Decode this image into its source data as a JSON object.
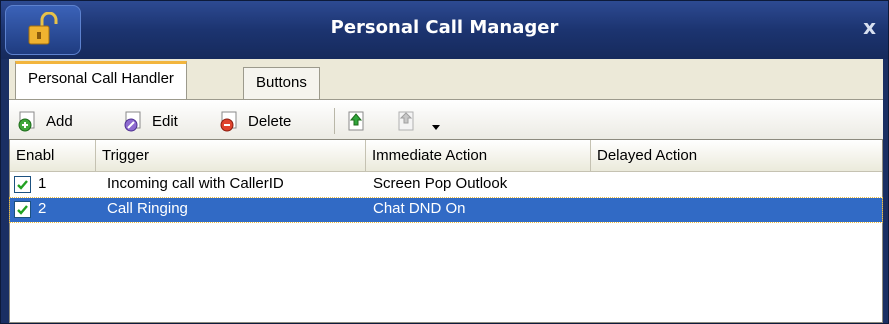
{
  "window": {
    "title": "Personal Call Manager",
    "close_glyph": "x",
    "lock_icon": "unlocked-padlock-icon"
  },
  "tabs": [
    {
      "label": "Personal Call Handler",
      "active": true
    },
    {
      "label": "Buttons",
      "active": false
    }
  ],
  "toolbar": {
    "add_label": "Add",
    "edit_label": "Edit",
    "delete_label": "Delete",
    "add_icon": "add-icon",
    "edit_icon": "edit-icon",
    "delete_icon": "delete-icon",
    "move_up_icon": "move-up-icon",
    "move_down_icon": "move-down-icon",
    "dropdown_icon": "dropdown-arrow-icon"
  },
  "table": {
    "columns": [
      "Enabl",
      "Trigger",
      "Immediate Action",
      "Delayed Action"
    ],
    "rows": [
      {
        "enabled": true,
        "number": "1",
        "trigger": "Incoming call with CallerID",
        "immediate": "Screen Pop Outlook",
        "delayed": "",
        "selected": false
      },
      {
        "enabled": true,
        "number": "2",
        "trigger": "Call Ringing",
        "immediate": "Chat DND On",
        "delayed": "",
        "selected": true
      }
    ]
  },
  "colors": {
    "titlebar": "#1c3470",
    "selection": "#316ac5",
    "active_tab_accent": "#f2b53d"
  }
}
